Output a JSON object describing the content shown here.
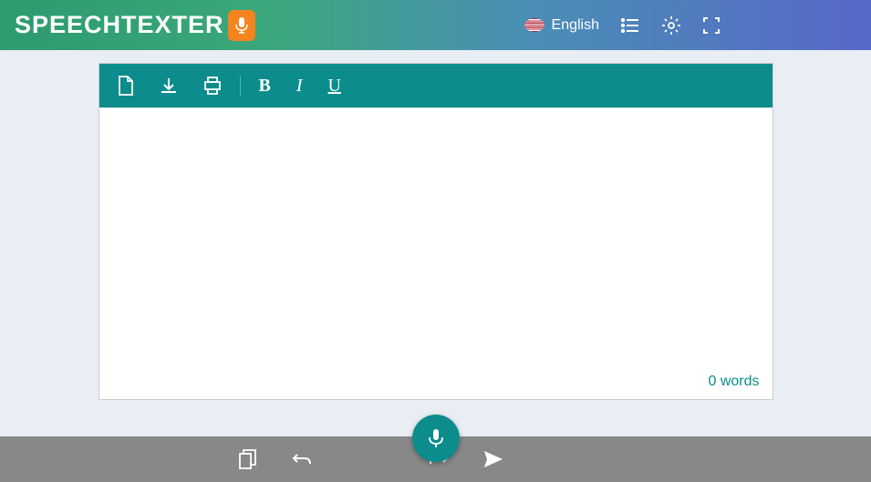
{
  "header": {
    "logo_text": "SPEECHTEXTER",
    "language": "English"
  },
  "toolbar": {
    "new_doc": "new-document",
    "download": "download",
    "print": "print",
    "bold": "B",
    "italic": "I",
    "underline": "U"
  },
  "editor": {
    "content": "",
    "word_count": "0 words"
  },
  "bottom": {
    "copy": "copy",
    "undo": "undo",
    "redo": "redo",
    "send": "send"
  }
}
